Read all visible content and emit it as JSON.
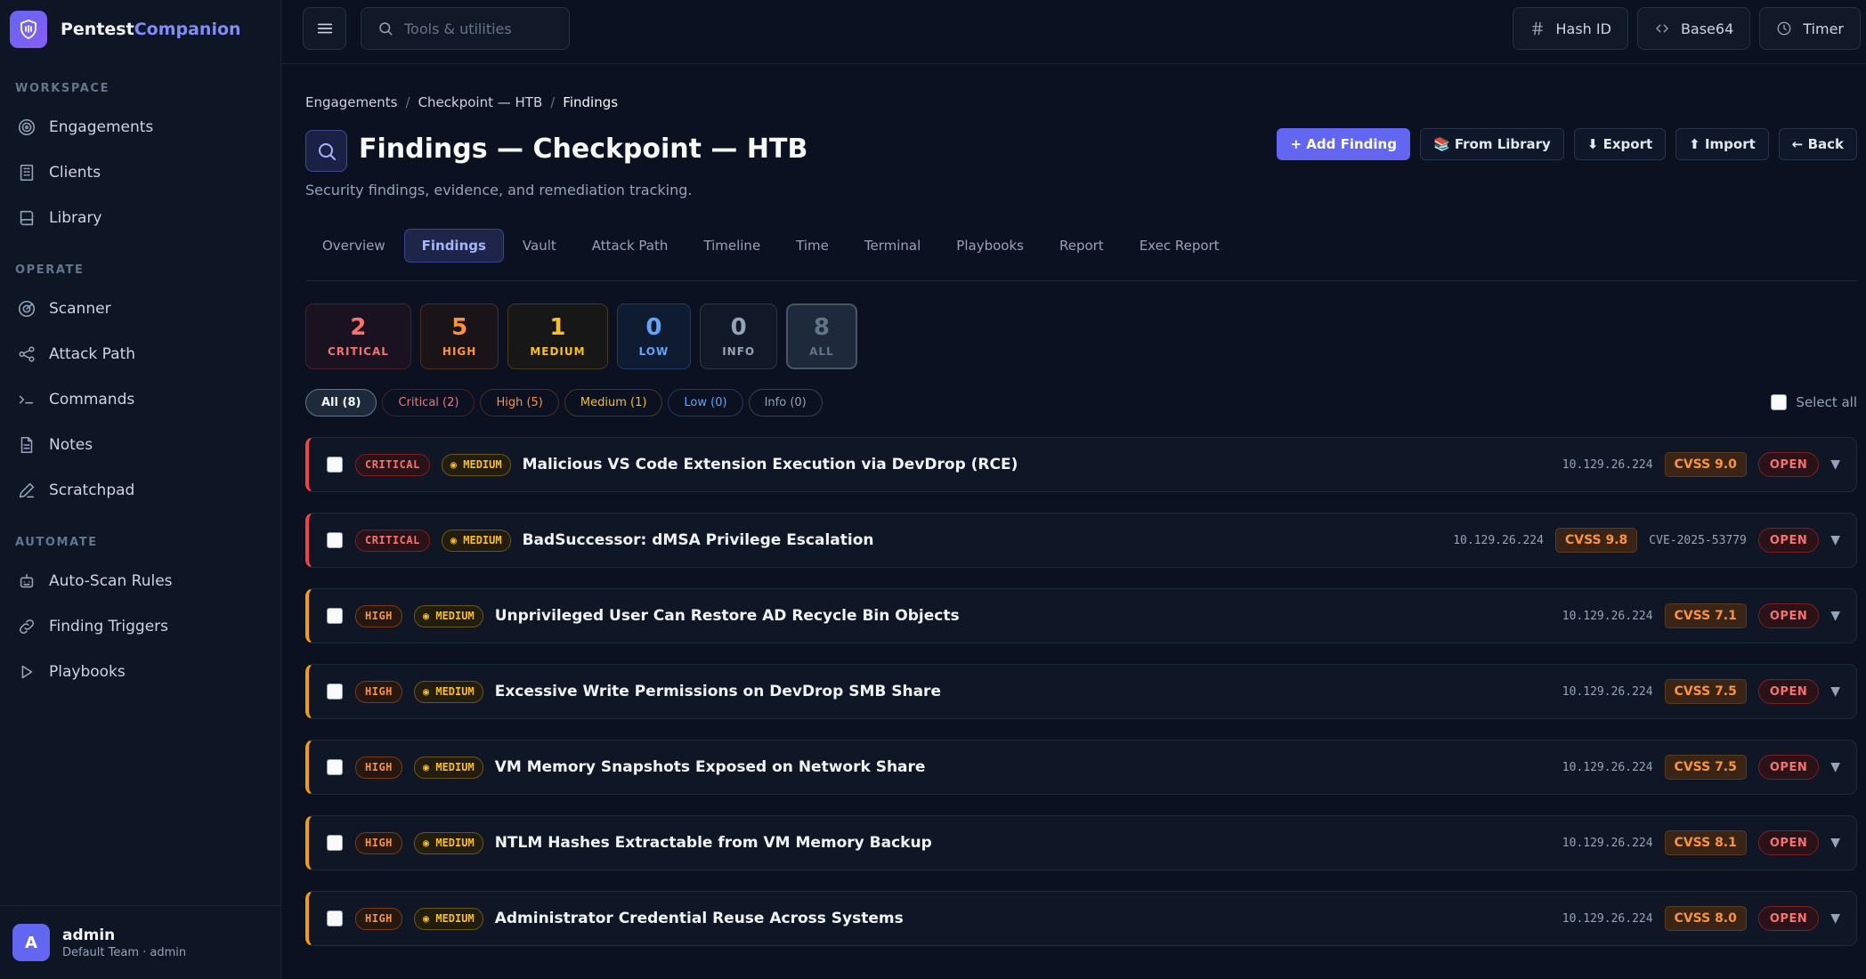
{
  "brand": {
    "name_part1": "Pentest",
    "name_part2": "Companion"
  },
  "sidebar": {
    "sections": [
      {
        "label": "WORKSPACE",
        "items": [
          {
            "label": "Engagements",
            "icon": "target-icon"
          },
          {
            "label": "Clients",
            "icon": "building-icon"
          },
          {
            "label": "Library",
            "icon": "book-icon"
          }
        ]
      },
      {
        "label": "OPERATE",
        "items": [
          {
            "label": "Scanner",
            "icon": "radar-icon"
          },
          {
            "label": "Attack Path",
            "icon": "share-icon"
          },
          {
            "label": "Commands",
            "icon": "terminal-icon"
          },
          {
            "label": "Notes",
            "icon": "file-icon"
          },
          {
            "label": "Scratchpad",
            "icon": "pencil-icon"
          }
        ]
      },
      {
        "label": "AUTOMATE",
        "items": [
          {
            "label": "Auto-Scan Rules",
            "icon": "robot-icon"
          },
          {
            "label": "Finding Triggers",
            "icon": "link-icon"
          },
          {
            "label": "Playbooks",
            "icon": "play-icon"
          }
        ]
      }
    ],
    "user": {
      "initial": "A",
      "name": "admin",
      "sub": "Default Team · admin"
    }
  },
  "topbar": {
    "search_placeholder": "Tools & utilities",
    "tools": [
      {
        "label": "Hash ID",
        "icon": "hash-icon"
      },
      {
        "label": "Base64",
        "icon": "code-icon"
      },
      {
        "label": "Timer",
        "icon": "clock-icon"
      }
    ]
  },
  "breadcrumb": [
    "Engagements",
    "Checkpoint — HTB",
    "Findings"
  ],
  "page": {
    "title": "Findings — Checkpoint — HTB",
    "subtitle": "Security findings, evidence, and remediation tracking.",
    "actions": [
      "+ Add Finding",
      "📚 From Library",
      "⬇ Export",
      "⬆ Import",
      "← Back"
    ]
  },
  "tabs": [
    "Overview",
    "Findings",
    "Vault",
    "Attack Path",
    "Timeline",
    "Time",
    "Terminal",
    "Playbooks",
    "Report",
    "Exec Report"
  ],
  "active_tab": "Findings",
  "stats": [
    {
      "key": "critical",
      "value": "2",
      "label": "CRITICAL"
    },
    {
      "key": "high",
      "value": "5",
      "label": "HIGH"
    },
    {
      "key": "medium",
      "value": "1",
      "label": "MEDIUM"
    },
    {
      "key": "low",
      "value": "0",
      "label": "LOW"
    },
    {
      "key": "info",
      "value": "0",
      "label": "INFO"
    },
    {
      "key": "all",
      "value": "8",
      "label": "ALL"
    }
  ],
  "filters": [
    {
      "key": "all",
      "label": "All (8)"
    },
    {
      "key": "critical",
      "label": "Critical (2)"
    },
    {
      "key": "high",
      "label": "High (5)"
    },
    {
      "key": "medium",
      "label": "Medium (1)"
    },
    {
      "key": "low",
      "label": "Low (0)"
    },
    {
      "key": "info",
      "label": "Info (0)"
    }
  ],
  "select_all_label": "Select all",
  "findings": [
    {
      "severity": "critical",
      "severity_label": "CRITICAL",
      "confidence": "◉ MEDIUM",
      "title": "Malicious VS Code Extension Execution via DevDrop (RCE)",
      "ip": "10.129.26.224",
      "cvss": "CVSS 9.0",
      "cve": "",
      "status": "OPEN"
    },
    {
      "severity": "critical",
      "severity_label": "CRITICAL",
      "confidence": "◉ MEDIUM",
      "title": "BadSuccessor: dMSA Privilege Escalation",
      "ip": "10.129.26.224",
      "cvss": "CVSS 9.8",
      "cve": "CVE-2025-53779",
      "status": "OPEN"
    },
    {
      "severity": "high",
      "severity_label": "HIGH",
      "confidence": "◉ MEDIUM",
      "title": "Unprivileged User Can Restore AD Recycle Bin Objects",
      "ip": "10.129.26.224",
      "cvss": "CVSS 7.1",
      "cve": "",
      "status": "OPEN"
    },
    {
      "severity": "high",
      "severity_label": "HIGH",
      "confidence": "◉ MEDIUM",
      "title": "Excessive Write Permissions on DevDrop SMB Share",
      "ip": "10.129.26.224",
      "cvss": "CVSS 7.5",
      "cve": "",
      "status": "OPEN"
    },
    {
      "severity": "high",
      "severity_label": "HIGH",
      "confidence": "◉ MEDIUM",
      "title": "VM Memory Snapshots Exposed on Network Share",
      "ip": "10.129.26.224",
      "cvss": "CVSS 7.5",
      "cve": "",
      "status": "OPEN"
    },
    {
      "severity": "high",
      "severity_label": "HIGH",
      "confidence": "◉ MEDIUM",
      "title": "NTLM Hashes Extractable from VM Memory Backup",
      "ip": "10.129.26.224",
      "cvss": "CVSS 8.1",
      "cve": "",
      "status": "OPEN"
    },
    {
      "severity": "high",
      "severity_label": "HIGH",
      "confidence": "◉ MEDIUM",
      "title": "Administrator Credential Reuse Across Systems",
      "ip": "10.129.26.224",
      "cvss": "CVSS 8.0",
      "cve": "",
      "status": "OPEN"
    }
  ],
  "colors": {
    "accent": "#6366f1",
    "critical": "#f87171",
    "high": "#fb923c",
    "medium": "#fbbf24",
    "low": "#60a5fa"
  }
}
